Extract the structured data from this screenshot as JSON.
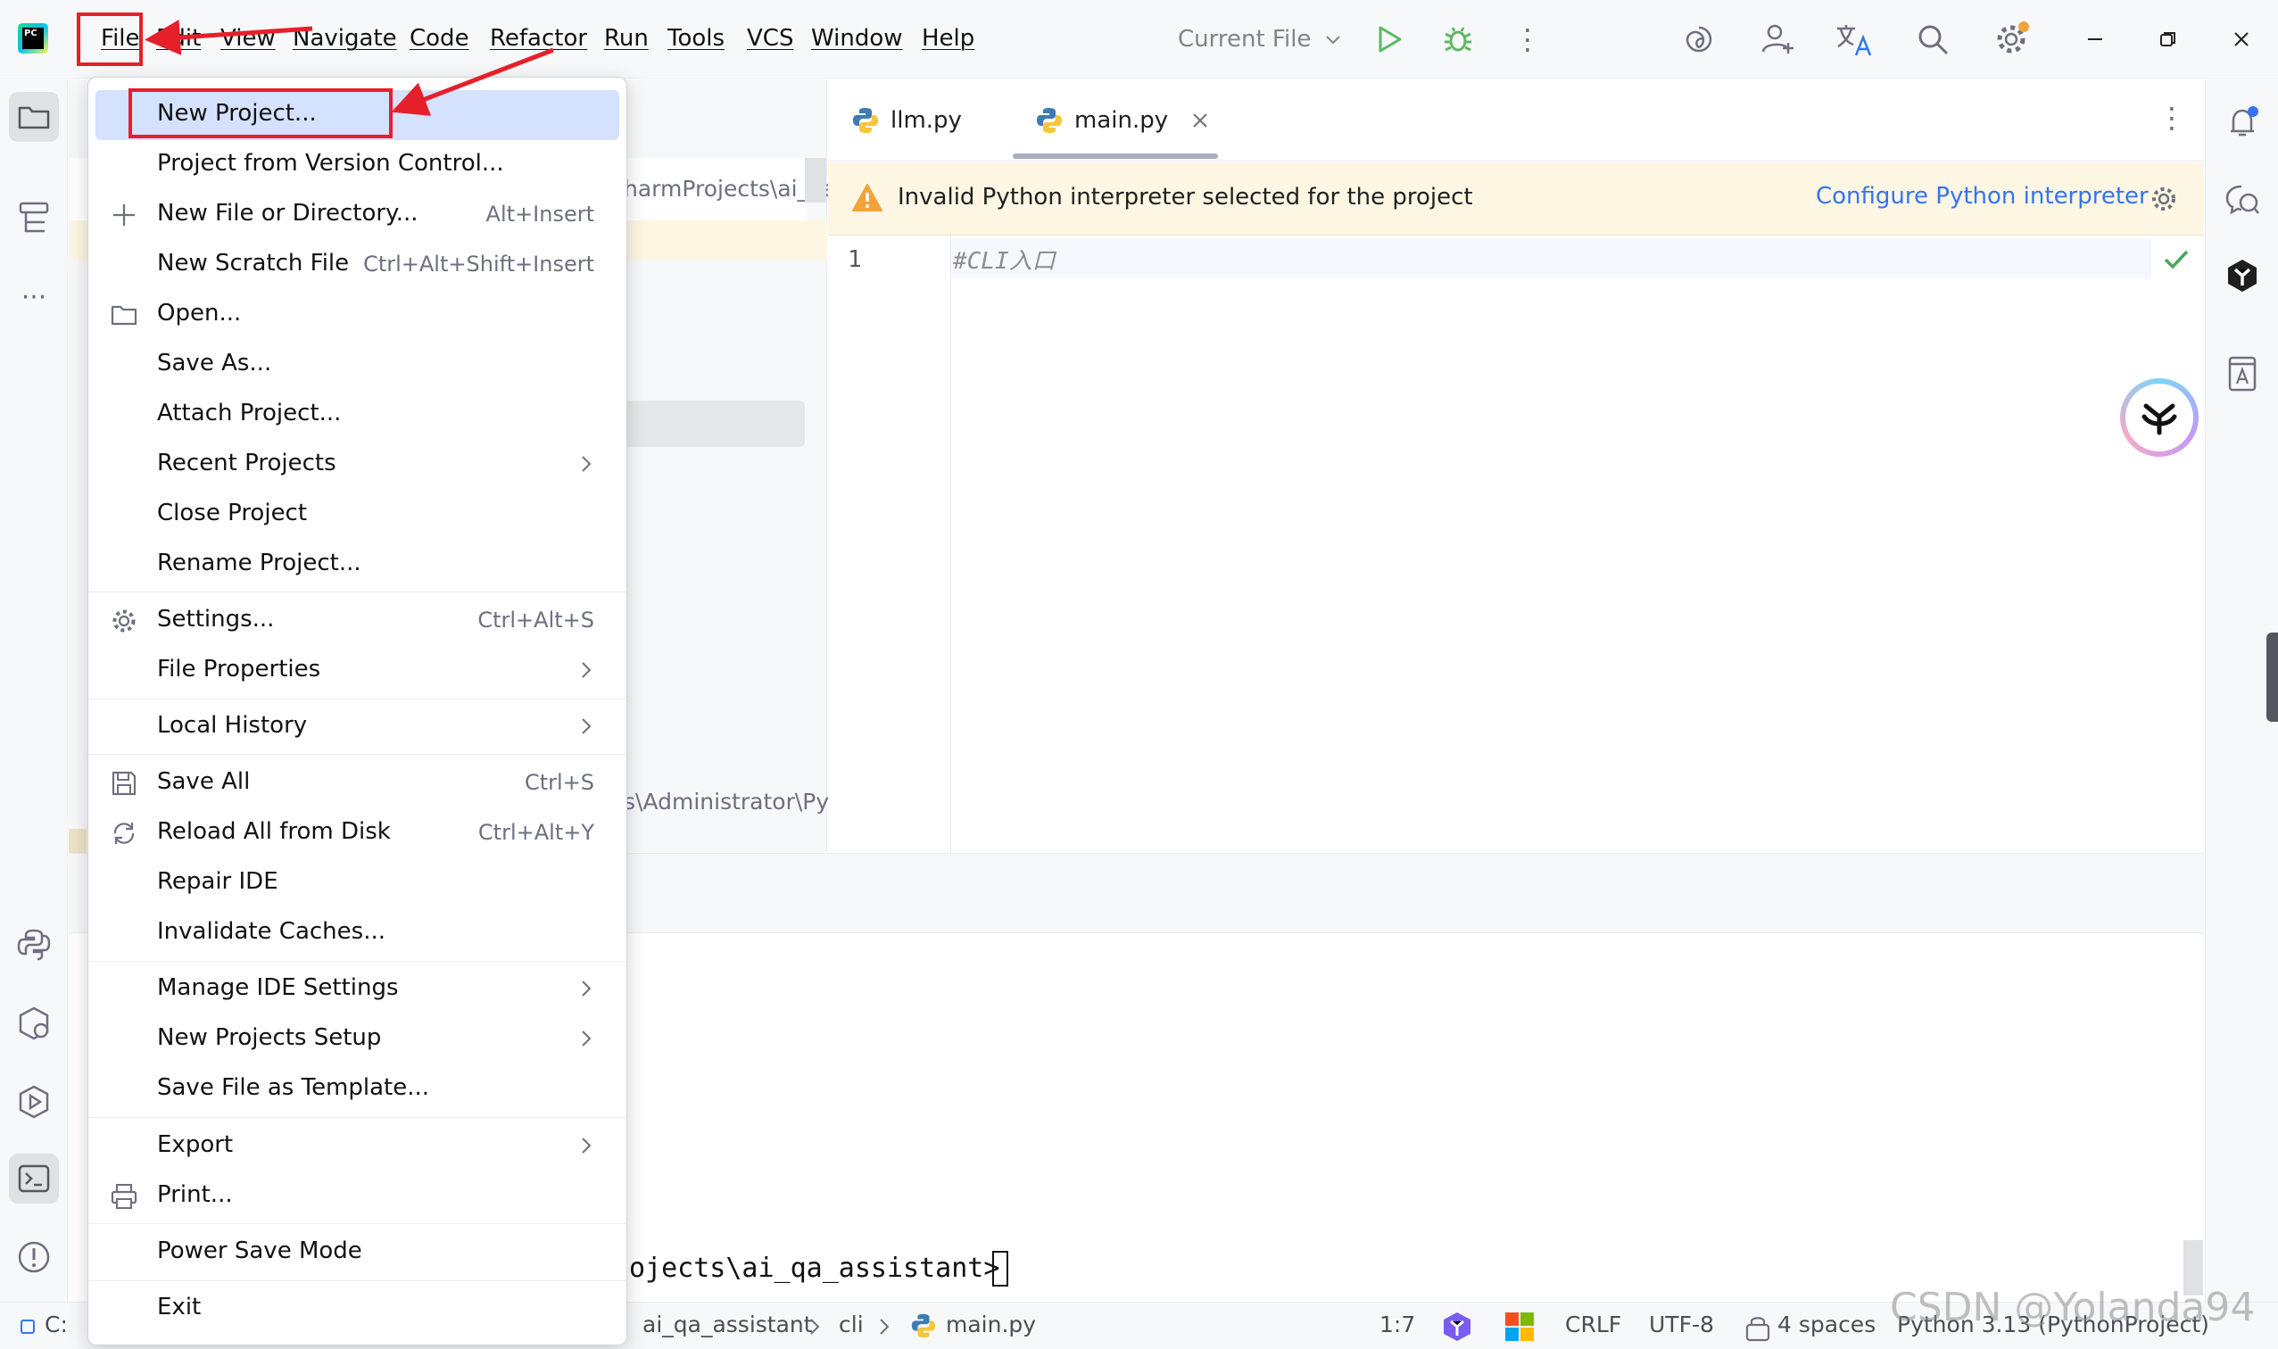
{
  "menubar": {
    "items": [
      "File",
      "Edit",
      "View",
      "Navigate",
      "Code",
      "Refactor",
      "Run",
      "Tools",
      "VCS",
      "Window",
      "Help"
    ],
    "run_config": "Current File"
  },
  "project_panel": {
    "path_fragment_top": "harmProjects\\ai_qa_",
    "path_fragment_mid": "s\\Administrator\\Pyc"
  },
  "editor": {
    "tabs": [
      {
        "label": "llm.py",
        "active": false
      },
      {
        "label": "main.py",
        "active": true
      }
    ],
    "warning": {
      "message": "Invalid Python interpreter selected for the project",
      "action": "Configure Python interpreter"
    },
    "line_number": "1",
    "code_line": "#CLI入口"
  },
  "terminal": {
    "prompt_text": "ojects\\ai_qa_assistant>"
  },
  "file_menu": {
    "items": [
      {
        "label": "New Project...",
        "shortcut": "",
        "submenu": false,
        "icon": "",
        "highlighted": true
      },
      {
        "label": "Project from Version Control...",
        "shortcut": "",
        "submenu": false,
        "icon": ""
      },
      {
        "label": "New File or Directory...",
        "shortcut": "Alt+Insert",
        "submenu": false,
        "icon": "plus-icon"
      },
      {
        "label": "New Scratch File",
        "shortcut": "Ctrl+Alt+Shift+Insert",
        "submenu": false,
        "icon": ""
      },
      {
        "label": "Open...",
        "shortcut": "",
        "submenu": false,
        "icon": "folder-icon"
      },
      {
        "label": "Save As...",
        "shortcut": "",
        "submenu": false,
        "icon": ""
      },
      {
        "label": "Attach Project...",
        "shortcut": "",
        "submenu": false,
        "icon": ""
      },
      {
        "label": "Recent Projects",
        "shortcut": "",
        "submenu": true,
        "icon": ""
      },
      {
        "label": "Close Project",
        "shortcut": "",
        "submenu": false,
        "icon": ""
      },
      {
        "label": "Rename Project...",
        "shortcut": "",
        "submenu": false,
        "icon": ""
      },
      {
        "label": "Settings...",
        "shortcut": "Ctrl+Alt+S",
        "submenu": false,
        "icon": "gear-icon"
      },
      {
        "label": "File Properties",
        "shortcut": "",
        "submenu": true,
        "icon": ""
      },
      {
        "label": "Local History",
        "shortcut": "",
        "submenu": true,
        "icon": ""
      },
      {
        "label": "Save All",
        "shortcut": "Ctrl+S",
        "submenu": false,
        "icon": "save-icon"
      },
      {
        "label": "Reload All from Disk",
        "shortcut": "Ctrl+Alt+Y",
        "submenu": false,
        "icon": "reload-icon"
      },
      {
        "label": "Repair IDE",
        "shortcut": "",
        "submenu": false,
        "icon": ""
      },
      {
        "label": "Invalidate Caches...",
        "shortcut": "",
        "submenu": false,
        "icon": ""
      },
      {
        "label": "Manage IDE Settings",
        "shortcut": "",
        "submenu": true,
        "icon": ""
      },
      {
        "label": "New Projects Setup",
        "shortcut": "",
        "submenu": true,
        "icon": ""
      },
      {
        "label": "Save File as Template...",
        "shortcut": "",
        "submenu": false,
        "icon": ""
      },
      {
        "label": "Export",
        "shortcut": "",
        "submenu": true,
        "icon": ""
      },
      {
        "label": "Print...",
        "shortcut": "",
        "submenu": false,
        "icon": "printer-icon"
      },
      {
        "label": "Power Save Mode",
        "shortcut": "",
        "submenu": false,
        "icon": ""
      },
      {
        "label": "Exit",
        "shortcut": "",
        "submenu": false,
        "icon": ""
      }
    ]
  },
  "statusbar": {
    "left_fragment": "C:",
    "breadcrumbs": [
      "ai_qa_assistant",
      "cli",
      "main.py"
    ],
    "position": "1:7",
    "line_separator": "CRLF",
    "encoding": "UTF-8",
    "indent": "4 spaces",
    "interpreter": "Python 3.13 (PythonProject)"
  },
  "watermark": "CSDN @Yolanda94",
  "colors": {
    "annotation_red": "#e5202a",
    "menu_highlight": "#d4e2ff",
    "link_blue": "#3574f0",
    "warning_bg": "#fdf6e3",
    "run_green": "#5fb865"
  }
}
